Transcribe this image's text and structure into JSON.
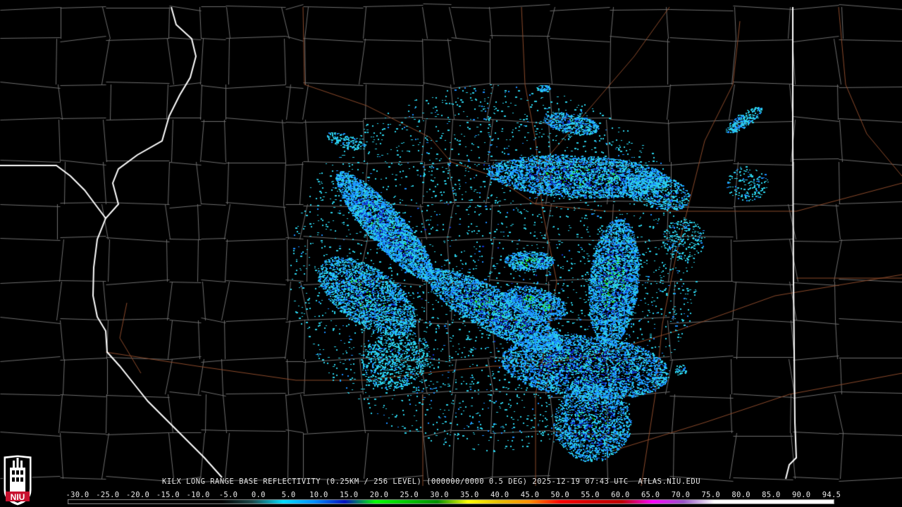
{
  "header": {
    "title": "KILX LONG RANGE BASE REFLECTIVITY (0.25KM / 256 LEVEL) (000000/0000 0.5 DEG) 2025-12-19 07:43 UTC  ATLAS.NIU.EDU"
  },
  "logo": {
    "text": "NIU",
    "colors": {
      "shield": "#c8102e",
      "tower": "#ffffff"
    }
  },
  "colorbar": {
    "labels": [
      "-30.0",
      "-25.0",
      "-20.0",
      "-15.0",
      "-10.0",
      "-5.0",
      "0.0",
      "5.0",
      "10.0",
      "15.0",
      "20.0",
      "25.0",
      "30.0",
      "35.0",
      "40.0",
      "45.0",
      "50.0",
      "55.0",
      "60.0",
      "65.0",
      "70.0",
      "75.0",
      "80.0",
      "85.0",
      "90.0",
      "94.5"
    ],
    "stops": [
      {
        "dbz": -30,
        "color": "#000000"
      },
      {
        "dbz": -5,
        "color": "#000000"
      },
      {
        "dbz": 0,
        "color": "#1a4a4a"
      },
      {
        "dbz": 5,
        "color": "#00e0ff"
      },
      {
        "dbz": 10,
        "color": "#0090ff"
      },
      {
        "dbz": 15,
        "color": "#0010c0"
      },
      {
        "dbz": 20,
        "color": "#00ff00"
      },
      {
        "dbz": 25,
        "color": "#00c800"
      },
      {
        "dbz": 30,
        "color": "#009000"
      },
      {
        "dbz": 35,
        "color": "#ffff00"
      },
      {
        "dbz": 40,
        "color": "#e7c000"
      },
      {
        "dbz": 45,
        "color": "#ff9000"
      },
      {
        "dbz": 50,
        "color": "#ff0000"
      },
      {
        "dbz": 55,
        "color": "#d60000"
      },
      {
        "dbz": 60,
        "color": "#c00000"
      },
      {
        "dbz": 65,
        "color": "#ff00ff"
      },
      {
        "dbz": 70,
        "color": "#9955c9"
      },
      {
        "dbz": 75,
        "color": "#ffffff"
      },
      {
        "dbz": 94.5,
        "color": "#ffffff"
      }
    ]
  },
  "map_colors": {
    "background": "#000000",
    "county_lines": "#6e6e6e",
    "state_lines": "#ffffff",
    "highways": "#8b4a2b",
    "echo_light": "#2bd0e8",
    "echo_mid": "#1a8cff",
    "echo_dark": "#1030c8",
    "echo_green": "#20e020",
    "echo_yellow": "#e8e040"
  }
}
